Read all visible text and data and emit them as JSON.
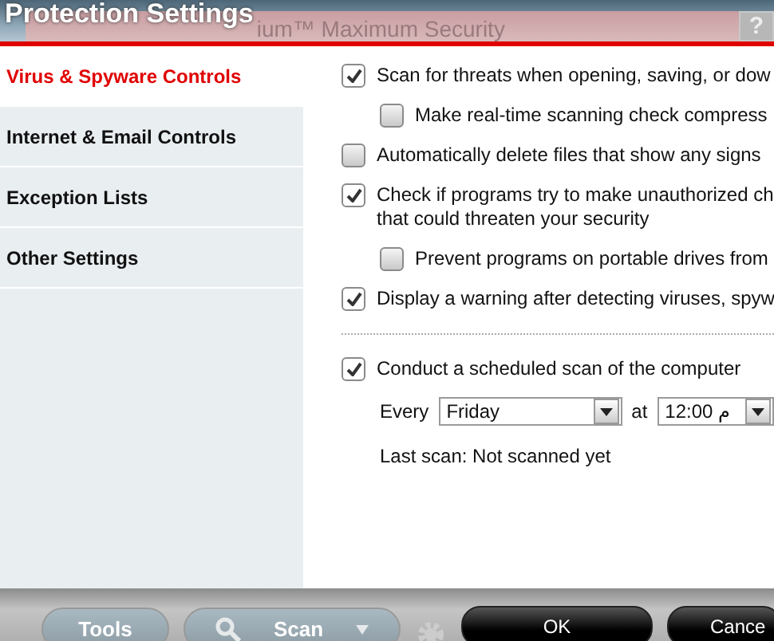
{
  "window": {
    "title": "Protection Settings",
    "background_title": "ium™ Maximum Security",
    "help_button": "?"
  },
  "sidebar": {
    "items": [
      {
        "label": "Virus & Spyware Controls",
        "selected": true
      },
      {
        "label": "Internet & Email Controls",
        "selected": false
      },
      {
        "label": "Exception Lists",
        "selected": false
      },
      {
        "label": "Other Settings",
        "selected": false
      }
    ]
  },
  "options": [
    {
      "label": "Scan for threats when opening, saving, or dow",
      "checked": true,
      "children": [
        {
          "label": "Make real-time scanning check compress",
          "checked": false
        }
      ]
    },
    {
      "label": "Automatically delete files that show any signs",
      "checked": false
    },
    {
      "label": "Check if programs try to make unauthorized ch\nthat could threaten your security",
      "checked": true,
      "children": [
        {
          "label": "Prevent programs on portable drives from",
          "checked": false
        }
      ]
    },
    {
      "label": "Display a warning after detecting viruses, spyw",
      "checked": true
    }
  ],
  "schedule": {
    "label": "Conduct a scheduled scan of the computer",
    "checked": true,
    "every_label": "Every",
    "day": "Friday",
    "at_label": "at",
    "time": "12:00 م",
    "last_scan": "Last scan: Not scanned yet"
  },
  "toolbar": {
    "tools": "Tools",
    "scan": "Scan",
    "ok": "OK",
    "cancel": "Cance"
  }
}
